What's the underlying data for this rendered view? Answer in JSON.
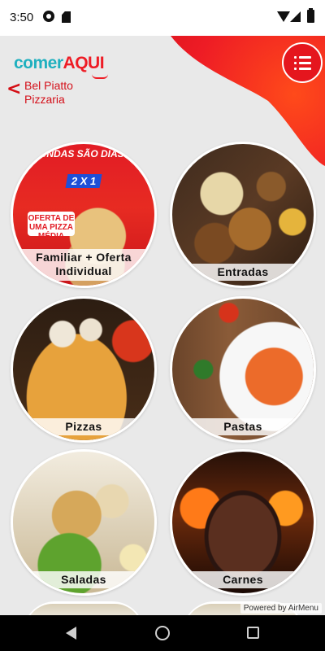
{
  "status_bar": {
    "time": "3:50"
  },
  "header": {
    "logo_part1": "comer",
    "logo_part2": "AQUI",
    "back_symbol": "<",
    "restaurant_name": "Bel Piatto Pizzaria",
    "menu_icon": "menu-list-icon"
  },
  "categories": [
    {
      "label": "Familiar + Oferta Individual",
      "promo_line1": "SEGUNDAS SÃO DIAS DE...",
      "promo_line2": "2 X 1",
      "promo_badge": "OFERTA DE UMA PIZZA MÉDIA"
    },
    {
      "label": "Entradas"
    },
    {
      "label": "Pizzas"
    },
    {
      "label": "Pastas"
    },
    {
      "label": "Saladas"
    },
    {
      "label": "Carnes"
    }
  ],
  "footer": {
    "powered_by": "Powered by AirMenu"
  },
  "colors": {
    "brand_red": "#ee1c25",
    "brand_teal": "#1fb0bf",
    "background": "#e9e9e9"
  }
}
